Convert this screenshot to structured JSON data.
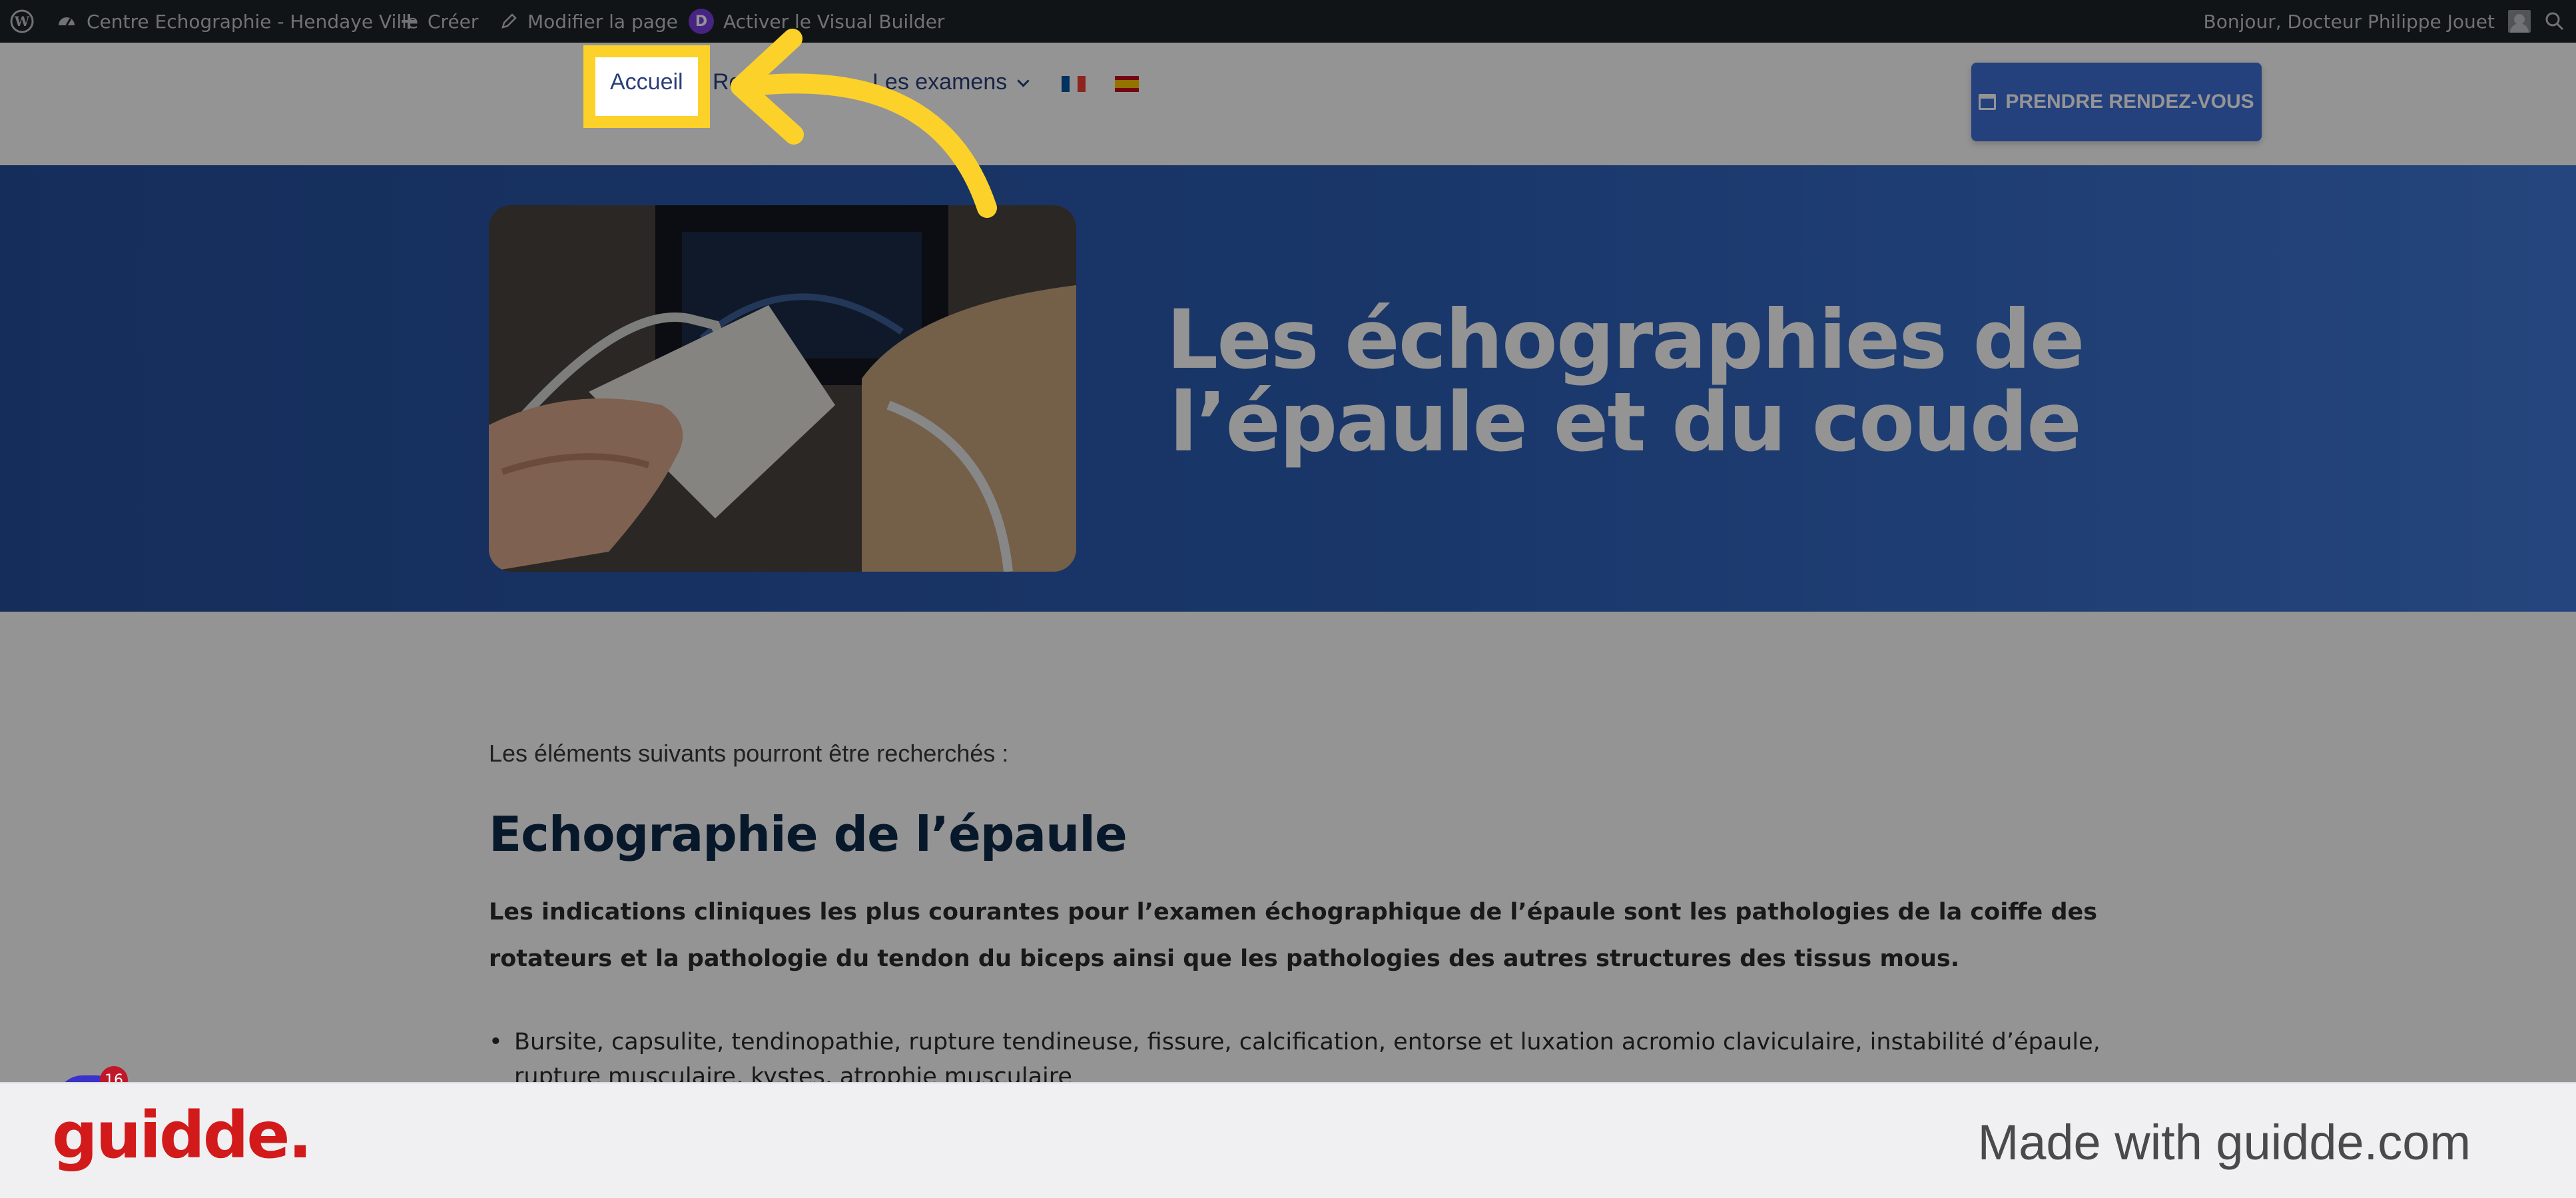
{
  "admin_bar": {
    "site_name": "Centre Echographie - Hendaye Ville",
    "create_label": "Créer",
    "edit_label": "Modifier la page",
    "builder_badge": "D",
    "builder_label": "Activer le Visual Builder",
    "greeting": "Bonjour, Docteur Philippe Jouet"
  },
  "nav": {
    "home": "Accueil",
    "item2": "Re",
    "exams": "Les examens",
    "cta": "PRENDRE RENDEZ-VOUS"
  },
  "hero": {
    "title_line1": "Les échographies de",
    "title_line2": "l’épaule et du coude"
  },
  "content": {
    "intro": "Les éléments suivants pourront être recherchés :",
    "heading": "Echographie de l’épaule",
    "paragraph": "Les indications cliniques les plus courantes pour l’examen échographique de l’épaule sont les pathologies de la coiffe des rotateurs et la pathologie du tendon du biceps ainsi que les pathologies des autres structures des tissus mous.",
    "bullet1": "Bursite, capsulite, tendinopathie, rupture tendineuse, fissure, calcification, entorse et luxation acromio claviculaire, instabilité d’épaule, rupture musculaire, kystes, atrophie musculaire"
  },
  "chat": {
    "badge_count": "16"
  },
  "footer": {
    "logo": "guidde.",
    "tagline": "Made with guidde.com"
  },
  "colors": {
    "highlight": "#fcd12a",
    "hero_blue": "#2d5fb7",
    "cta_blue": "#3f6fd8",
    "brand_red": "#d31a1a"
  }
}
